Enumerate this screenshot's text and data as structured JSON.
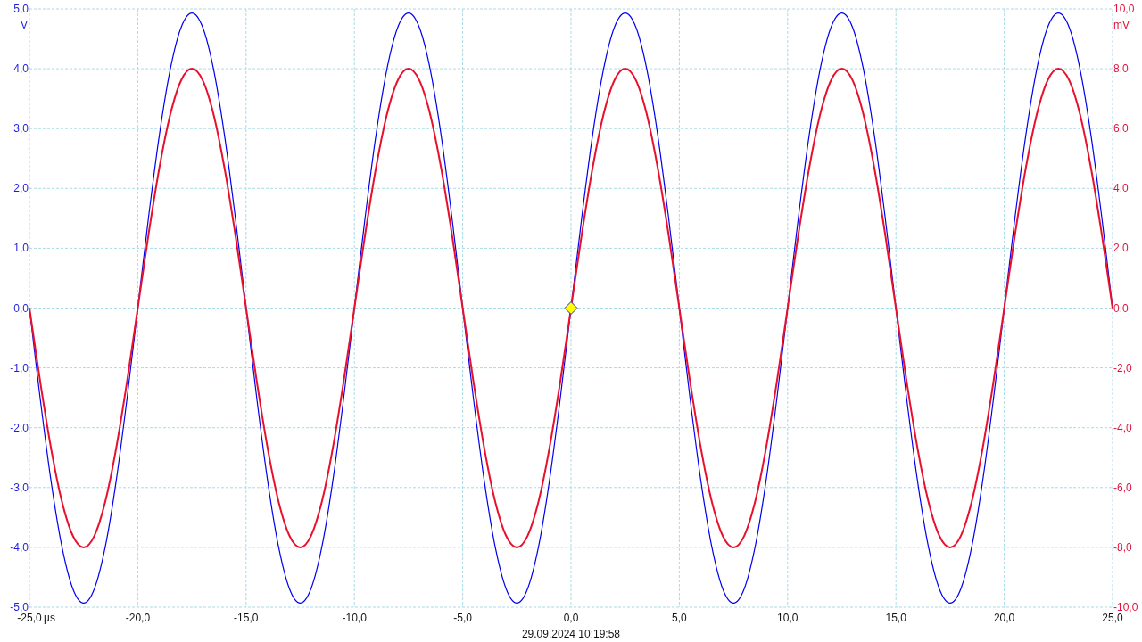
{
  "chart_data": {
    "type": "line",
    "grid": true,
    "xlabel": "µs",
    "ylabel": "V",
    "y2label": "mV",
    "xlim": [
      -25,
      25
    ],
    "ylim": [
      -5,
      5
    ],
    "y2lim": [
      -10,
      10
    ],
    "xticks": [
      {
        "value": -25,
        "label": "-25,0"
      },
      {
        "value": -20,
        "label": "-20,0"
      },
      {
        "value": -15,
        "label": "-15,0"
      },
      {
        "value": -10,
        "label": "-10,0"
      },
      {
        "value": -5,
        "label": "-5,0"
      },
      {
        "value": 0,
        "label": "0,0"
      },
      {
        "value": 5,
        "label": "5,0"
      },
      {
        "value": 10,
        "label": "10,0"
      },
      {
        "value": 15,
        "label": "15,0"
      },
      {
        "value": 20,
        "label": "20,0"
      },
      {
        "value": 25,
        "label": "25,0"
      }
    ],
    "yticks": [
      {
        "value": 5,
        "label": "5,0"
      },
      {
        "value": 4,
        "label": "4,0"
      },
      {
        "value": 3,
        "label": "3,0"
      },
      {
        "value": 2,
        "label": "2,0"
      },
      {
        "value": 1,
        "label": "1,0"
      },
      {
        "value": 0,
        "label": "0,0"
      },
      {
        "value": -1,
        "label": "-1,0"
      },
      {
        "value": -2,
        "label": "-2,0"
      },
      {
        "value": -3,
        "label": "-3,0"
      },
      {
        "value": -4,
        "label": "-4,0"
      },
      {
        "value": -5,
        "label": "-5,0"
      }
    ],
    "y2ticks": [
      {
        "value": 10,
        "label": "10,0"
      },
      {
        "value": 8,
        "label": "8,0"
      },
      {
        "value": 6,
        "label": "6,0"
      },
      {
        "value": 4,
        "label": "4,0"
      },
      {
        "value": 2,
        "label": "2,0"
      },
      {
        "value": 0,
        "label": "0,0"
      },
      {
        "value": -2,
        "label": "-2,0"
      },
      {
        "value": -4,
        "label": "-4,0"
      },
      {
        "value": -6,
        "label": "-6,0"
      },
      {
        "value": -8,
        "label": "-8,0"
      },
      {
        "value": -10,
        "label": "-10,0"
      }
    ],
    "x": [
      -25,
      -24.5,
      -24,
      -23.5,
      -23,
      -22.5,
      -22,
      -21.5,
      -21,
      -20.5,
      -20,
      -19.5,
      -19,
      -18.5,
      -18,
      -17.5,
      -17,
      -16.5,
      -16,
      -15.5,
      -15,
      -14.5,
      -14,
      -13.5,
      -13,
      -12.5,
      -12,
      -11.5,
      -11,
      -10.5,
      -10,
      -9.5,
      -9,
      -8.5,
      -8,
      -7.5,
      -7,
      -6.5,
      -6,
      -5.5,
      -5,
      -4.5,
      -4,
      -3.5,
      -3,
      -2.5,
      -2,
      -1.5,
      -1,
      -0.5,
      0,
      0.5,
      1,
      1.5,
      2,
      2.5,
      3,
      3.5,
      4,
      4.5,
      5,
      5.5,
      6,
      6.5,
      7,
      7.5,
      8,
      8.5,
      9,
      9.5,
      10,
      10.5,
      11,
      11.5,
      12,
      12.5,
      13,
      13.5,
      14,
      14.5,
      15,
      15.5,
      16,
      16.5,
      17,
      17.5,
      18,
      18.5,
      19,
      19.5,
      20,
      20.5,
      21,
      21.5,
      22,
      22.5,
      23,
      23.5,
      24,
      24.5,
      25
    ],
    "series": [
      {
        "color": "#0000ee",
        "values": [
          0,
          -1.52,
          -2.9,
          -3.99,
          -4.69,
          -4.93,
          -4.69,
          -3.99,
          -2.9,
          -1.52,
          0,
          1.52,
          2.9,
          3.99,
          4.69,
          4.93,
          4.69,
          3.99,
          2.9,
          1.52,
          0,
          -1.52,
          -2.9,
          -3.99,
          -4.69,
          -4.93,
          -4.69,
          -3.99,
          -2.9,
          -1.52,
          0,
          1.52,
          2.9,
          3.99,
          4.69,
          4.93,
          4.69,
          3.99,
          2.9,
          1.52,
          0,
          -1.52,
          -2.9,
          -3.99,
          -4.69,
          -4.93,
          -4.69,
          -3.99,
          -2.9,
          -1.52,
          0,
          1.52,
          2.9,
          3.99,
          4.69,
          4.93,
          4.69,
          3.99,
          2.9,
          1.52,
          0,
          -1.52,
          -2.9,
          -3.99,
          -4.69,
          -4.93,
          -4.69,
          -3.99,
          -2.9,
          -1.52,
          0,
          1.52,
          2.9,
          3.99,
          4.69,
          4.93,
          4.69,
          3.99,
          2.9,
          1.52,
          0,
          -1.52,
          -2.9,
          -3.99,
          -4.69,
          -4.93,
          -4.69,
          -3.99,
          -2.9,
          -1.52,
          0,
          1.52,
          2.9,
          3.99,
          4.69,
          4.93,
          4.69,
          3.99,
          2.9,
          1.52,
          0
        ]
      },
      {
        "axis": "y2",
        "color": "#e8102c",
        "values": [
          0,
          -2.47,
          -4.7,
          -6.47,
          -7.61,
          -8,
          -7.61,
          -6.47,
          -4.7,
          -2.47,
          0,
          2.47,
          4.7,
          6.47,
          7.61,
          8,
          7.61,
          6.47,
          4.7,
          2.47,
          0,
          -2.47,
          -4.7,
          -6.47,
          -7.61,
          -8,
          -7.61,
          -6.47,
          -4.7,
          -2.47,
          0,
          2.47,
          4.7,
          6.47,
          7.61,
          8,
          7.61,
          6.47,
          4.7,
          2.47,
          0,
          -2.47,
          -4.7,
          -6.47,
          -7.61,
          -8,
          -7.61,
          -6.47,
          -4.7,
          -2.47,
          0,
          2.47,
          4.7,
          6.47,
          7.61,
          8,
          7.61,
          6.47,
          4.7,
          2.47,
          0,
          -2.47,
          -4.7,
          -6.47,
          -7.61,
          -8,
          -7.61,
          -6.47,
          -4.7,
          -2.47,
          0,
          2.47,
          4.7,
          6.47,
          7.61,
          8,
          7.61,
          6.47,
          4.7,
          2.47,
          0,
          -2.47,
          -4.7,
          -6.47,
          -7.61,
          -8,
          -7.61,
          -6.47,
          -4.7,
          -2.47,
          0,
          2.47,
          4.7,
          6.47,
          7.61,
          8,
          7.61,
          6.47,
          4.7,
          2.47,
          0
        ]
      }
    ]
  },
  "timestamp": "29.09.2024 10:19:58"
}
